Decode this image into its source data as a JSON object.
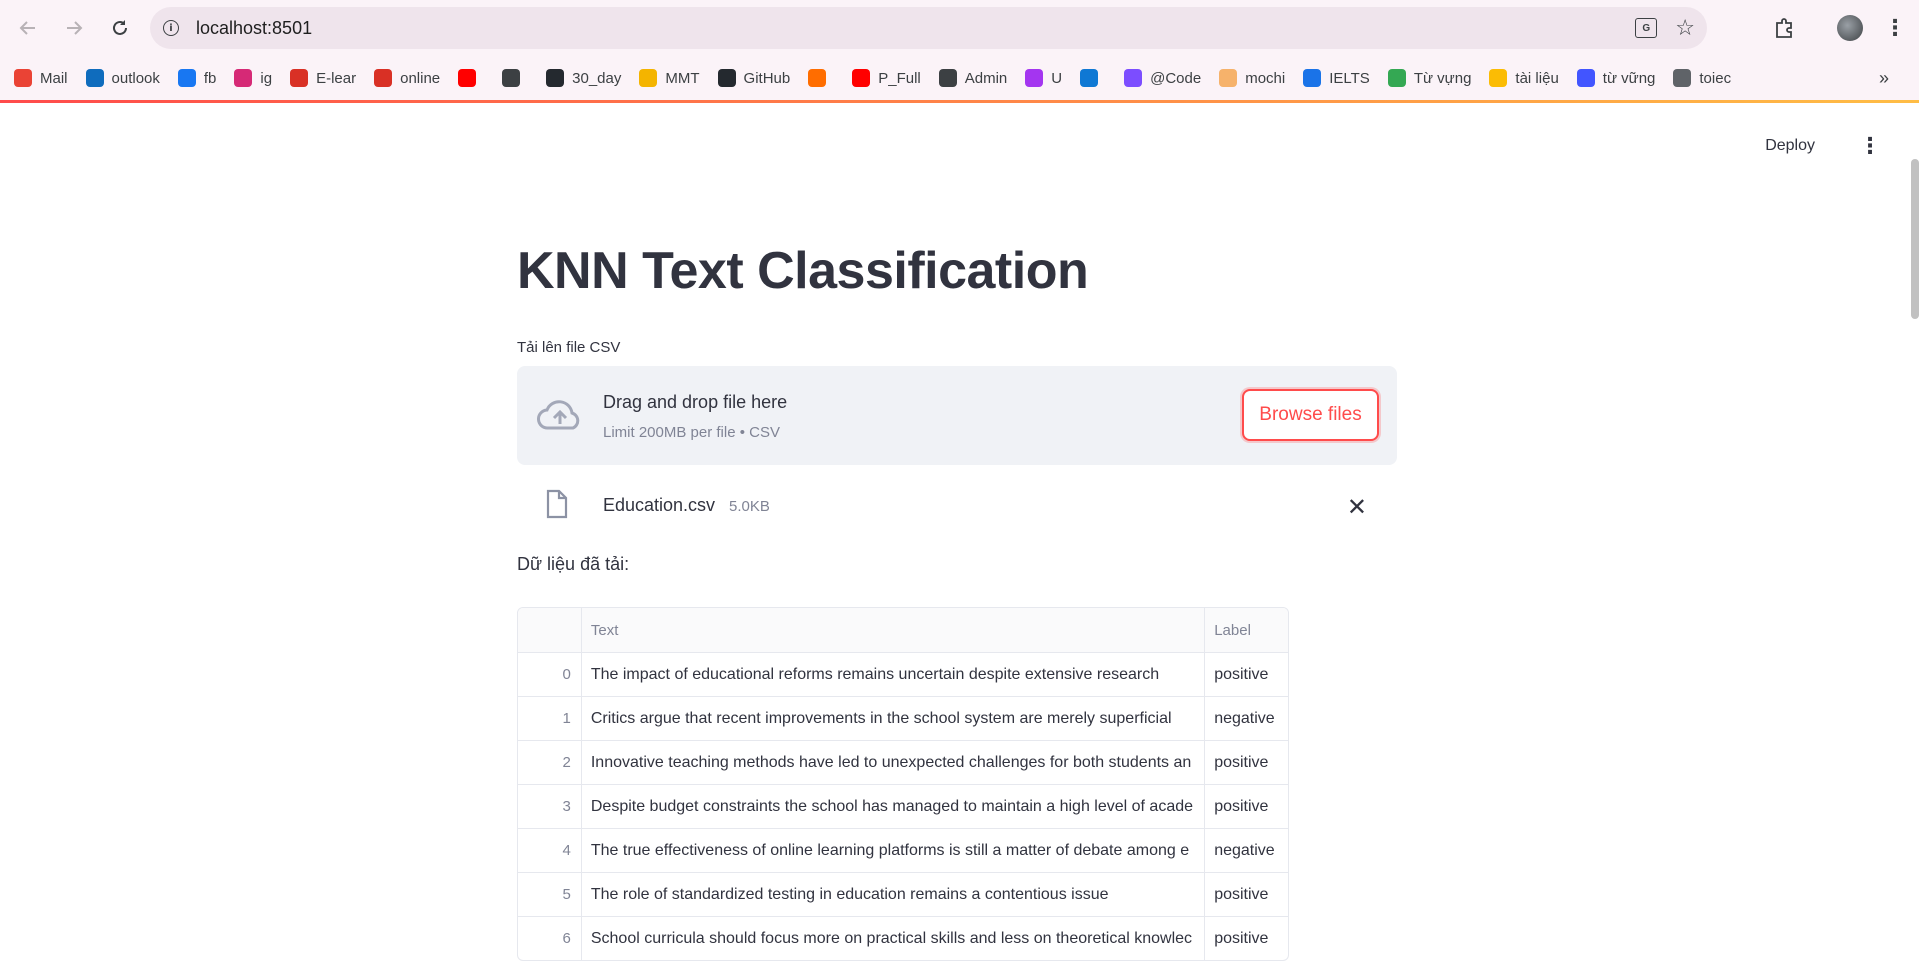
{
  "browser": {
    "url": "localhost:8501"
  },
  "bookmarks": [
    {
      "label": "Mail",
      "icon": "gmail-icon",
      "color": "#ea4335"
    },
    {
      "label": "outlook",
      "icon": "outlook-icon",
      "color": "#0f6cbd"
    },
    {
      "label": "fb",
      "icon": "facebook-icon",
      "color": "#1877f2"
    },
    {
      "label": "ig",
      "icon": "instagram-icon",
      "color": "#d62976"
    },
    {
      "label": "E-lear",
      "icon": "shield-icon",
      "color": "#d93025"
    },
    {
      "label": "online",
      "icon": "shield-icon",
      "color": "#d93025"
    },
    {
      "label": "",
      "icon": "youtube-icon",
      "color": "#ff0000"
    },
    {
      "label": "",
      "icon": "chatgpt-icon",
      "color": "#3c4043"
    },
    {
      "label": "30_day",
      "icon": "github-icon",
      "color": "#24292f"
    },
    {
      "label": "MMT",
      "icon": "classroom-icon",
      "color": "#f4b400"
    },
    {
      "label": "GitHub",
      "icon": "github-icon",
      "color": "#24292f"
    },
    {
      "label": "",
      "icon": "codepen-icon",
      "color": "#ff6d00"
    },
    {
      "label": "P_Full",
      "icon": "youtube-icon",
      "color": "#ff0000"
    },
    {
      "label": "Admin",
      "icon": "globe-icon",
      "color": "#3c4043"
    },
    {
      "label": "U",
      "icon": "udemy-icon",
      "color": "#a435f0"
    },
    {
      "label": "",
      "icon": "onedrive-icon",
      "color": "#0f78d4"
    },
    {
      "label": "@Code",
      "icon": "code-icon",
      "color": "#7c4dff"
    },
    {
      "label": "mochi",
      "icon": "mochi-icon",
      "color": "#f6b26b"
    },
    {
      "label": "IELTS",
      "icon": "ielts-icon",
      "color": "#1a73e8"
    },
    {
      "label": "Từ vựng",
      "icon": "globe-icon",
      "color": "#34a853"
    },
    {
      "label": "tài liệu",
      "icon": "drive-icon",
      "color": "#fbbc04"
    },
    {
      "label": "từ vững",
      "icon": "quizlet-icon",
      "color": "#4255ff"
    },
    {
      "label": "toiec",
      "icon": "t-icon",
      "color": "#5f6368"
    }
  ],
  "app": {
    "deploy_label": "Deploy",
    "title": "KNN Text Classification",
    "upload_label": "Tải lên file CSV",
    "dropzone_main": "Drag and drop file here",
    "dropzone_sub": "Limit 200MB per file • CSV",
    "browse_label": "Browse files",
    "file_name": "Education.csv",
    "file_size": "5.0KB",
    "data_label": "Dữ liệu đã tải:"
  },
  "table": {
    "columns": [
      "",
      "Text",
      "Label"
    ],
    "rows": [
      {
        "idx": "0",
        "text": "The impact of educational reforms remains uncertain despite extensive research",
        "label": "positive"
      },
      {
        "idx": "1",
        "text": "Critics argue that recent improvements in the school system are merely superficial",
        "label": "negative"
      },
      {
        "idx": "2",
        "text": "Innovative teaching methods have led to unexpected challenges for both students an",
        "label": "positive"
      },
      {
        "idx": "3",
        "text": "Despite budget constraints the school has managed to maintain a high level of acade",
        "label": "positive"
      },
      {
        "idx": "4",
        "text": "The true effectiveness of online learning platforms is still a matter of debate among e",
        "label": "negative"
      },
      {
        "idx": "5",
        "text": "The role of standardized testing in education remains a contentious issue",
        "label": "positive"
      },
      {
        "idx": "6",
        "text": "School curricula should focus more on practical skills and less on theoretical knowlec",
        "label": "positive"
      }
    ]
  }
}
